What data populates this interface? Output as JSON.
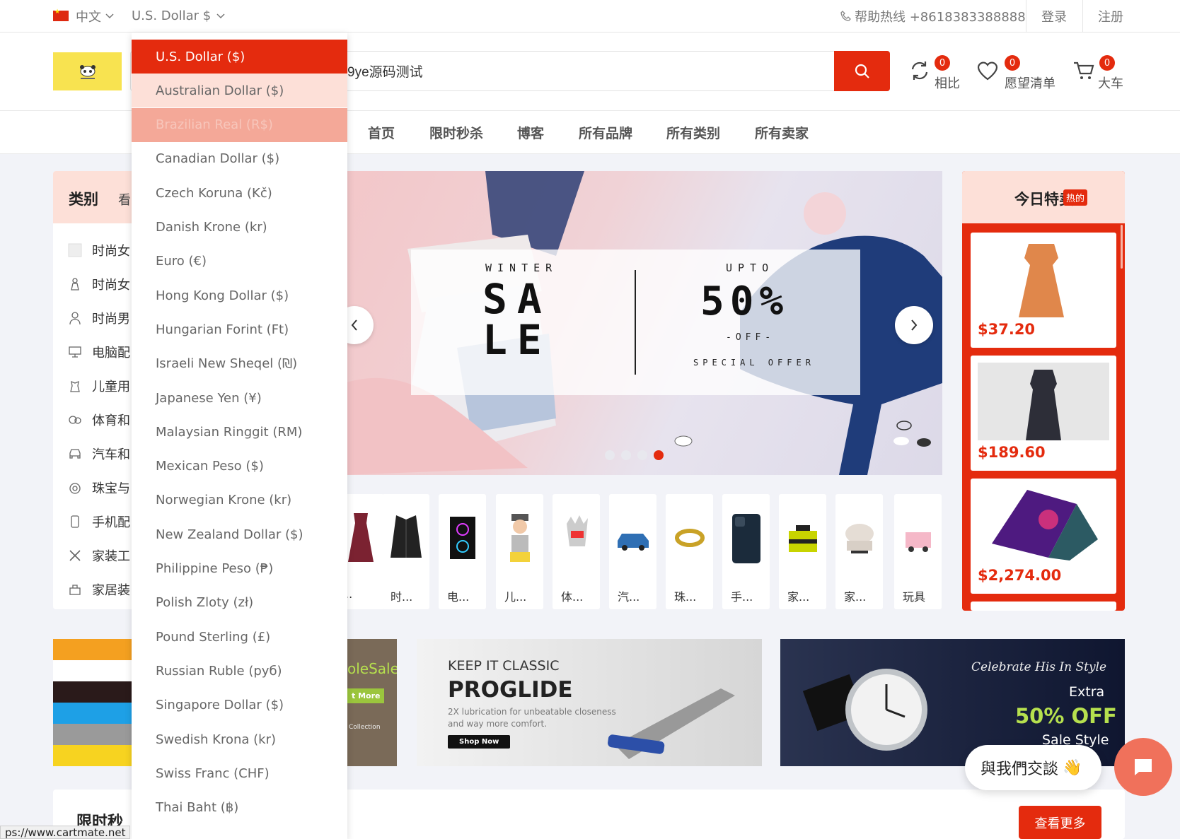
{
  "topbar": {
    "language": "中文",
    "currency": "U.S. Dollar $",
    "hotline": "帮助热线 +8618383388888",
    "login": "登录",
    "register": "注册"
  },
  "header": {
    "search_value": "9ye源码测试",
    "compare": {
      "label": "相比",
      "count": "0"
    },
    "wishlist": {
      "label": "愿望清单",
      "count": "0"
    },
    "cart": {
      "label": "大车",
      "count": "0"
    }
  },
  "nav": {
    "items": [
      "首页",
      "限时秒杀",
      "博客",
      "所有品牌",
      "所有类别",
      "所有卖家"
    ]
  },
  "categories": {
    "title": "类别",
    "view_all": "看",
    "items": [
      "时尚女",
      "时尚女",
      "时尚男",
      "电脑配",
      "儿童用",
      "体育和",
      "汽车和",
      "珠宝与",
      "手机配",
      "家装工",
      "家居装"
    ]
  },
  "banner": {
    "left_top": "WINTER",
    "left_big_1": "SA",
    "left_big_2": "LE",
    "right_top": "UPTO",
    "right_big": "50%",
    "right_off": "-OFF-",
    "right_bottom": "SPECIAL OFFER",
    "active_slide": 4,
    "slide_count": 4
  },
  "product_strip": [
    "..",
    "时...",
    "电...",
    "儿...",
    "体...",
    "汽...",
    "珠...",
    "手...",
    "家...",
    "家...",
    "玩具"
  ],
  "deals": {
    "title": "今日特卖",
    "badge": "热的",
    "items": [
      {
        "price": "$37.20"
      },
      {
        "price": "$189.60"
      },
      {
        "price": "$2,274.00"
      }
    ]
  },
  "promos": {
    "p1_text": "oleSale",
    "p1_btn": "t More",
    "p1_sub": "Collection",
    "p2_line1": "KEEP IT CLASSIC",
    "p2_line2": "PROGLIDE",
    "p2_line3": "2X lubrication for unbeatable closeness",
    "p2_line4": "and way more comfort.",
    "p2_btn": "Shop Now",
    "p3_line1": "Celebrate His In Style",
    "p3_line2": "Extra",
    "p3_line3": "50% OFF",
    "p3_line4": "Sale Style"
  },
  "flash_title": "限时秒",
  "see_more": "查看更多",
  "chat": {
    "label": "與我們交談",
    "emoji": "👋"
  },
  "status_url": "ps://www.cartmate.net",
  "currency_dropdown": {
    "items": [
      "U.S. Dollar ($)",
      "Australian Dollar ($)",
      "Brazilian Real (R$)",
      "Canadian Dollar ($)",
      "Czech Koruna (Kč)",
      "Danish Krone (kr)",
      "Euro (€)",
      "Hong Kong Dollar ($)",
      "Hungarian Forint (Ft)",
      "Israeli New Sheqel (₪)",
      "Japanese Yen (¥)",
      "Malaysian Ringgit (RM)",
      "Mexican Peso ($)",
      "Norwegian Krone (kr)",
      "New Zealand Dollar ($)",
      "Philippine Peso (₱)",
      "Polish Zloty (zł)",
      "Pound Sterling (£)",
      "Russian Ruble (руб)",
      "Singapore Dollar ($)",
      "Swedish Krona (kr)",
      "Swiss Franc (CHF)",
      "Thai Baht (฿)"
    ],
    "selected": "U.S. Dollar ($)",
    "hovered": "Australian Dollar ($)"
  },
  "colors": {
    "accent": "#e42b0e",
    "selected_bg": "#e42b0e",
    "hover_bg": "#fde0d8",
    "pressed_bg": "#f4a898"
  }
}
